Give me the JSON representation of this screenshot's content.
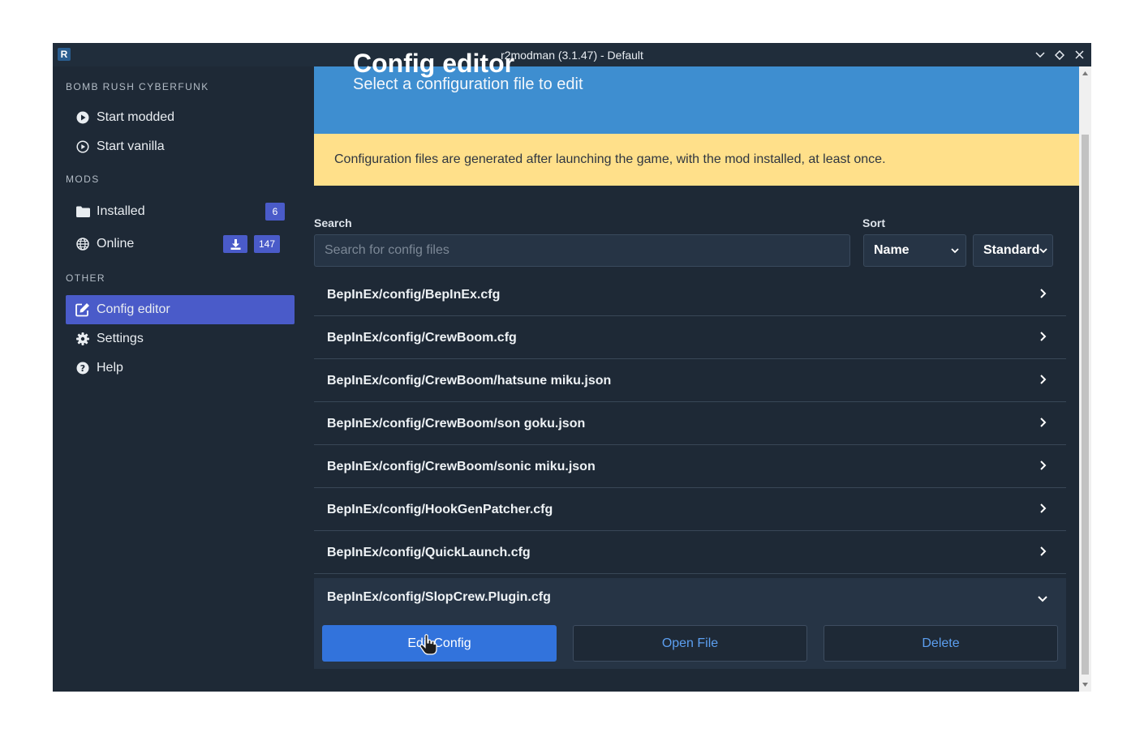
{
  "window": {
    "title": "r2modman (3.1.47) - Default",
    "logo_letter": "R"
  },
  "sidebar": {
    "game_label": "BOMB RUSH CYBERFUNK",
    "start_modded": "Start modded",
    "start_vanilla": "Start vanilla",
    "mods_label": "MODS",
    "installed": "Installed",
    "installed_count": "6",
    "online": "Online",
    "online_count": "147",
    "other_label": "OTHER",
    "config_editor": "Config editor",
    "settings": "Settings",
    "help": "Help"
  },
  "main": {
    "hero_title_partial": "Config editor",
    "hero_subtitle": "Select a configuration file to edit",
    "notice": "Configuration files are generated after launching the game, with the mod installed, at least once.",
    "search_label": "Search",
    "search_placeholder": "Search for config files",
    "search_value": "",
    "sort_label": "Sort",
    "sort_by": "Name",
    "sort_order": "Standard",
    "files": [
      "BepInEx/config/BepInEx.cfg",
      "BepInEx/config/CrewBoom.cfg",
      "BepInEx/config/CrewBoom/hatsune miku.json",
      "BepInEx/config/CrewBoom/son goku.json",
      "BepInEx/config/CrewBoom/sonic miku.json",
      "BepInEx/config/HookGenPatcher.cfg",
      "BepInEx/config/QuickLaunch.cfg"
    ],
    "expanded_file": "BepInEx/config/SlopCrew.Plugin.cfg",
    "edit_button": "Edit Config",
    "open_button": "Open File",
    "delete_button": "Delete"
  },
  "colors": {
    "accent": "#4a5bc9",
    "hero": "#3e8ed0",
    "notice": "#ffe08a",
    "primary_button": "#3273dc"
  }
}
